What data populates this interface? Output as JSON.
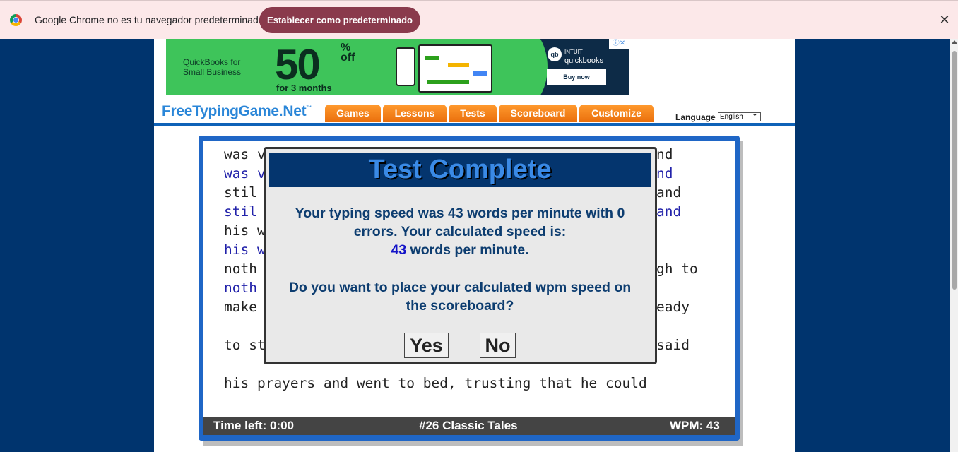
{
  "infobar": {
    "message": "Google Chrome no es tu navegador predeterminado",
    "button_label": "Establecer como predeterminado",
    "close_glyph": "✕"
  },
  "ad": {
    "brand": "QuickBooks for Small Business",
    "discount": "50",
    "percent": "%",
    "off": "off",
    "months": "for 3 months",
    "company_top": "INTUIT",
    "company": "quickbooks",
    "logo": "qb",
    "buy_label": "Buy now",
    "choices_glyph": "ⓘ✕"
  },
  "nav": {
    "logo_text": "FreeTypingGame.Net",
    "logo_tm": "™",
    "tabs": [
      "Games",
      "Lessons",
      "Tests",
      "Scoreboard",
      "Customize"
    ],
    "language_label": "Language",
    "language_value": "English"
  },
  "typing": {
    "lines": [
      {
        "left": "was v",
        "right": "nd",
        "typed": false
      },
      {
        "left": "was v",
        "right": "nd",
        "typed": true
      },
      {
        "left": "stil",
        "right": "and",
        "typed": false
      },
      {
        "left": "stil",
        "right": "and",
        "typed": true
      },
      {
        "left": "his w",
        "right": "",
        "typed": false
      },
      {
        "left": "his w",
        "right": "",
        "typed": true
      },
      {
        "left": "noth",
        "right": "gh to",
        "typed": false
      },
      {
        "left": "noth",
        "right": "",
        "typed": true
      },
      {
        "left": "make",
        "right": "eady",
        "typed": false
      },
      {
        "left": "to st",
        "right": "said",
        "typed": false
      },
      {
        "full": "his prayers and went to bed, trusting that he could",
        "typed": false
      }
    ]
  },
  "status": {
    "time_left": "Time left: 0:00",
    "test_name": "#26 Classic Tales",
    "wpm": "WPM: 43"
  },
  "modal": {
    "title": "Test Complete",
    "message_line1": "Your typing speed was 43 words per minute with 0",
    "message_line2": "errors. Your calculated speed is:",
    "speed_value": "43",
    "speed_suffix": " words per minute.",
    "question_line1": "Do you want to place your calculated wpm speed on",
    "question_line2": "the scoreboard?",
    "yes_label": "Yes",
    "no_label": "No"
  },
  "colors": {
    "page_background": "#00346e",
    "nav_orange": "#ff9a2e",
    "frame_blue": "#1f66c6",
    "modal_title_bg": "#04356e"
  }
}
